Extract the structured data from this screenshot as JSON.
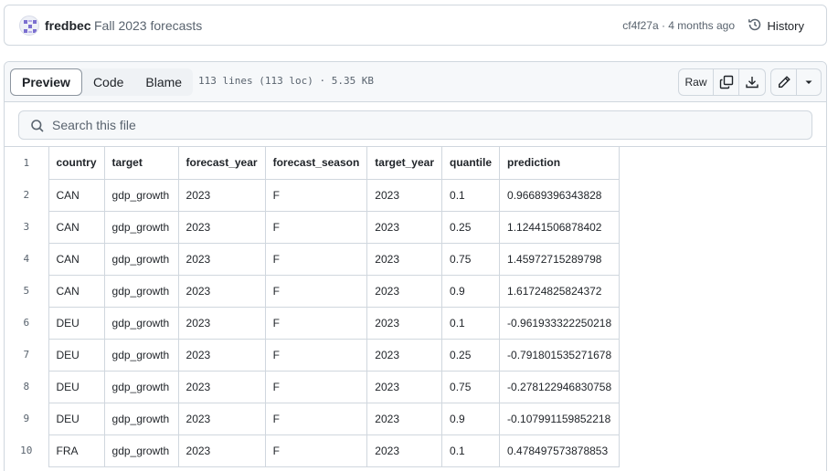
{
  "commit": {
    "author": "fredbec",
    "message": "Fall 2023 forecasts",
    "meta": "cf4f27a · 4 months ago",
    "history_label": "History"
  },
  "file": {
    "tabs": [
      {
        "label": "Preview",
        "active": true
      },
      {
        "label": "Code",
        "active": false
      },
      {
        "label": "Blame",
        "active": false
      }
    ],
    "info": "113 lines (113 loc) · 5.35 KB",
    "raw_label": "Raw",
    "icons": [
      "copy-icon",
      "download-icon",
      "pencil-icon",
      "triangle-down-icon"
    ]
  },
  "search": {
    "placeholder": "Search this file"
  },
  "table": {
    "header_line": "1",
    "columns": [
      "country",
      "target",
      "forecast_year",
      "forecast_season",
      "target_year",
      "quantile",
      "prediction"
    ],
    "rows": [
      {
        "line": "2",
        "cells": [
          "CAN",
          "gdp_growth",
          "2023",
          "F",
          "2023",
          "0.1",
          "0.96689396343828"
        ]
      },
      {
        "line": "3",
        "cells": [
          "CAN",
          "gdp_growth",
          "2023",
          "F",
          "2023",
          "0.25",
          "1.12441506878402"
        ]
      },
      {
        "line": "4",
        "cells": [
          "CAN",
          "gdp_growth",
          "2023",
          "F",
          "2023",
          "0.75",
          "1.45972715289798"
        ]
      },
      {
        "line": "5",
        "cells": [
          "CAN",
          "gdp_growth",
          "2023",
          "F",
          "2023",
          "0.9",
          "1.61724825824372"
        ]
      },
      {
        "line": "6",
        "cells": [
          "DEU",
          "gdp_growth",
          "2023",
          "F",
          "2023",
          "0.1",
          "-0.961933322250218"
        ]
      },
      {
        "line": "7",
        "cells": [
          "DEU",
          "gdp_growth",
          "2023",
          "F",
          "2023",
          "0.25",
          "-0.791801535271678"
        ]
      },
      {
        "line": "8",
        "cells": [
          "DEU",
          "gdp_growth",
          "2023",
          "F",
          "2023",
          "0.75",
          "-0.278122946830758"
        ]
      },
      {
        "line": "9",
        "cells": [
          "DEU",
          "gdp_growth",
          "2023",
          "F",
          "2023",
          "0.9",
          "-0.107991159852218"
        ]
      },
      {
        "line": "10",
        "cells": [
          "FRA",
          "gdp_growth",
          "2023",
          "F",
          "2023",
          "0.1",
          "0.478497573878853"
        ]
      }
    ]
  }
}
